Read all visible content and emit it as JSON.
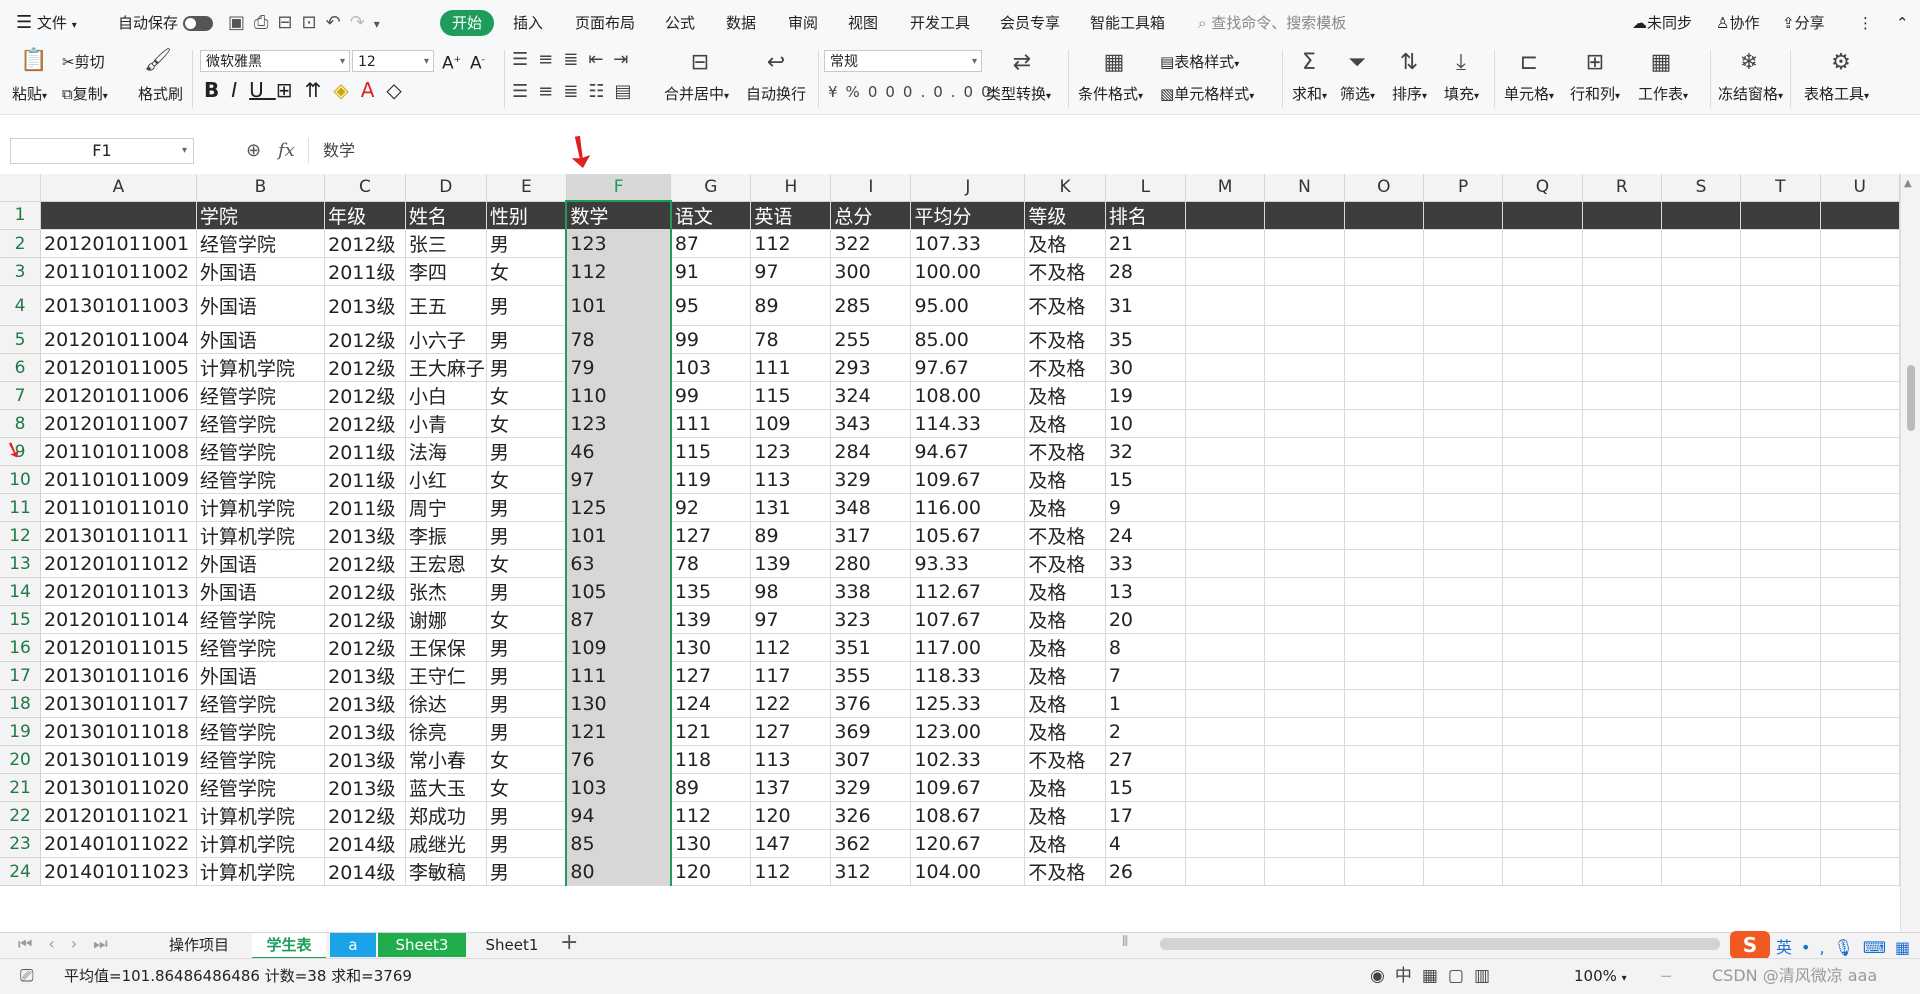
{
  "menubar": {
    "file_label": "文件",
    "autosave_label": "自动保存",
    "tabs": [
      "开始",
      "插入",
      "页面布局",
      "公式",
      "数据",
      "审阅",
      "视图",
      "开发工具",
      "会员专享",
      "智能工具箱"
    ],
    "search_placeholder": "查找命令、搜索模板",
    "sync_label": "未同步",
    "collab_label": "协作",
    "share_label": "分享"
  },
  "ribbon": {
    "paste": "粘贴",
    "cut": "剪切",
    "copy": "复制",
    "format_painter": "格式刷",
    "font_name": "微软雅黑",
    "font_size": "12",
    "merge_center": "合并居中",
    "wrap_text": "自动换行",
    "number_format": "常规",
    "type_convert": "类型转换",
    "cond_format": "条件格式",
    "table_style": "表格样式",
    "cell_style": "单元格样式",
    "sum": "求和",
    "filter": "筛选",
    "sort": "排序",
    "fill": "填充",
    "cell": "单元格",
    "rows_cols": "行和列",
    "worksheet": "工作表",
    "freeze": "冻结窗格",
    "table_tools": "表格工具"
  },
  "formula": {
    "cell_ref": "F1",
    "fx": "fx",
    "content": "数学"
  },
  "grid": {
    "columns": [
      "A",
      "B",
      "C",
      "D",
      "E",
      "F",
      "G",
      "H",
      "I",
      "J",
      "K",
      "L",
      "M",
      "N",
      "O",
      "P",
      "Q",
      "R",
      "S",
      "T",
      "U"
    ],
    "selected_column": "F",
    "header_row": [
      "",
      "学院",
      "年级",
      "姓名",
      "性别",
      "数学",
      "语文",
      "英语",
      "总分",
      "平均分",
      "等级",
      "排名"
    ],
    "rows": [
      [
        "201201011001",
        "经管学院",
        "2012级",
        "张三",
        "男",
        "123",
        "87",
        "112",
        "322",
        "107.33",
        "及格",
        "21"
      ],
      [
        "201101011002",
        "外国语",
        "2011级",
        "李四",
        "女",
        "112",
        "91",
        "97",
        "300",
        "100.00",
        "不及格",
        "28"
      ],
      [
        "201301011003",
        "外国语",
        "2013级",
        "王五",
        "男",
        "101",
        "95",
        "89",
        "285",
        "95.00",
        "不及格",
        "31"
      ],
      [
        "201201011004",
        "外国语",
        "2012级",
        "小六子",
        "男",
        "78",
        "99",
        "78",
        "255",
        "85.00",
        "不及格",
        "35"
      ],
      [
        "201201011005",
        "计算机学院",
        "2012级",
        "王大麻子",
        "男",
        "79",
        "103",
        "111",
        "293",
        "97.67",
        "不及格",
        "30"
      ],
      [
        "201201011006",
        "经管学院",
        "2012级",
        "小白",
        "女",
        "110",
        "99",
        "115",
        "324",
        "108.00",
        "及格",
        "19"
      ],
      [
        "201201011007",
        "经管学院",
        "2012级",
        "小青",
        "女",
        "123",
        "111",
        "109",
        "343",
        "114.33",
        "及格",
        "10"
      ],
      [
        "201101011008",
        "经管学院",
        "2011级",
        "法海",
        "男",
        "46",
        "115",
        "123",
        "284",
        "94.67",
        "不及格",
        "32"
      ],
      [
        "201101011009",
        "经管学院",
        "2011级",
        "小红",
        "女",
        "97",
        "119",
        "113",
        "329",
        "109.67",
        "及格",
        "15"
      ],
      [
        "201101011010",
        "计算机学院",
        "2011级",
        "周宁",
        "男",
        "125",
        "92",
        "131",
        "348",
        "116.00",
        "及格",
        "9"
      ],
      [
        "201301011011",
        "计算机学院",
        "2013级",
        "李振",
        "男",
        "101",
        "127",
        "89",
        "317",
        "105.67",
        "不及格",
        "24"
      ],
      [
        "201201011012",
        "外国语",
        "2012级",
        "王宏恩",
        "女",
        "63",
        "78",
        "139",
        "280",
        "93.33",
        "不及格",
        "33"
      ],
      [
        "201201011013",
        "外国语",
        "2012级",
        "张杰",
        "男",
        "105",
        "135",
        "98",
        "338",
        "112.67",
        "及格",
        "13"
      ],
      [
        "201201011014",
        "经管学院",
        "2012级",
        "谢娜",
        "女",
        "87",
        "139",
        "97",
        "323",
        "107.67",
        "及格",
        "20"
      ],
      [
        "201201011015",
        "经管学院",
        "2012级",
        "王保保",
        "男",
        "109",
        "130",
        "112",
        "351",
        "117.00",
        "及格",
        "8"
      ],
      [
        "201301011016",
        "外国语",
        "2013级",
        "王守仁",
        "男",
        "111",
        "127",
        "117",
        "355",
        "118.33",
        "及格",
        "7"
      ],
      [
        "201301011017",
        "经管学院",
        "2013级",
        "徐达",
        "男",
        "130",
        "124",
        "122",
        "376",
        "125.33",
        "及格",
        "1"
      ],
      [
        "201301011018",
        "经管学院",
        "2013级",
        "徐亮",
        "男",
        "121",
        "121",
        "127",
        "369",
        "123.00",
        "及格",
        "2"
      ],
      [
        "201301011019",
        "经管学院",
        "2013级",
        "常小春",
        "女",
        "76",
        "118",
        "113",
        "307",
        "102.33",
        "不及格",
        "27"
      ],
      [
        "201301011020",
        "经管学院",
        "2013级",
        "蓝大玉",
        "女",
        "103",
        "89",
        "137",
        "329",
        "109.67",
        "及格",
        "15"
      ],
      [
        "201201011021",
        "计算机学院",
        "2012级",
        "郑成功",
        "男",
        "94",
        "112",
        "120",
        "326",
        "108.67",
        "及格",
        "17"
      ],
      [
        "201401011022",
        "计算机学院",
        "2014级",
        "戚继光",
        "男",
        "85",
        "130",
        "147",
        "362",
        "120.67",
        "及格",
        "4"
      ],
      [
        "201401011023",
        "计算机学院",
        "2014级",
        "李敏稿",
        "男",
        "80",
        "120",
        "112",
        "312",
        "104.00",
        "不及格",
        "26"
      ]
    ]
  },
  "sheet_tabs": [
    {
      "label": "操作项目",
      "color": "#f3f3f3",
      "text": "#222",
      "active": false
    },
    {
      "label": "学生表",
      "color": "#ffffff",
      "text": "#1d9c5b",
      "active": true
    },
    {
      "label": "a",
      "color": "#1aa3e8",
      "text": "#ffffff",
      "active": false
    },
    {
      "label": "Sheet3",
      "color": "#1fae4b",
      "text": "#ffffff",
      "active": false
    },
    {
      "label": "Sheet1",
      "color": "#f3f3f3",
      "text": "#222",
      "active": false
    }
  ],
  "status": {
    "average": "平均值=101.86486486486",
    "count": "计数=38",
    "sum": "求和=3769",
    "zoom": "100%",
    "watermark": "CSDN @清风微凉 aaa",
    "ime_label": "英"
  },
  "colors": {
    "accent": "#1d9c5b",
    "header_fill": "#3d3d3d",
    "selected_col_fill": "#d7d7d7",
    "annotation_arrow": "#e0201c"
  }
}
